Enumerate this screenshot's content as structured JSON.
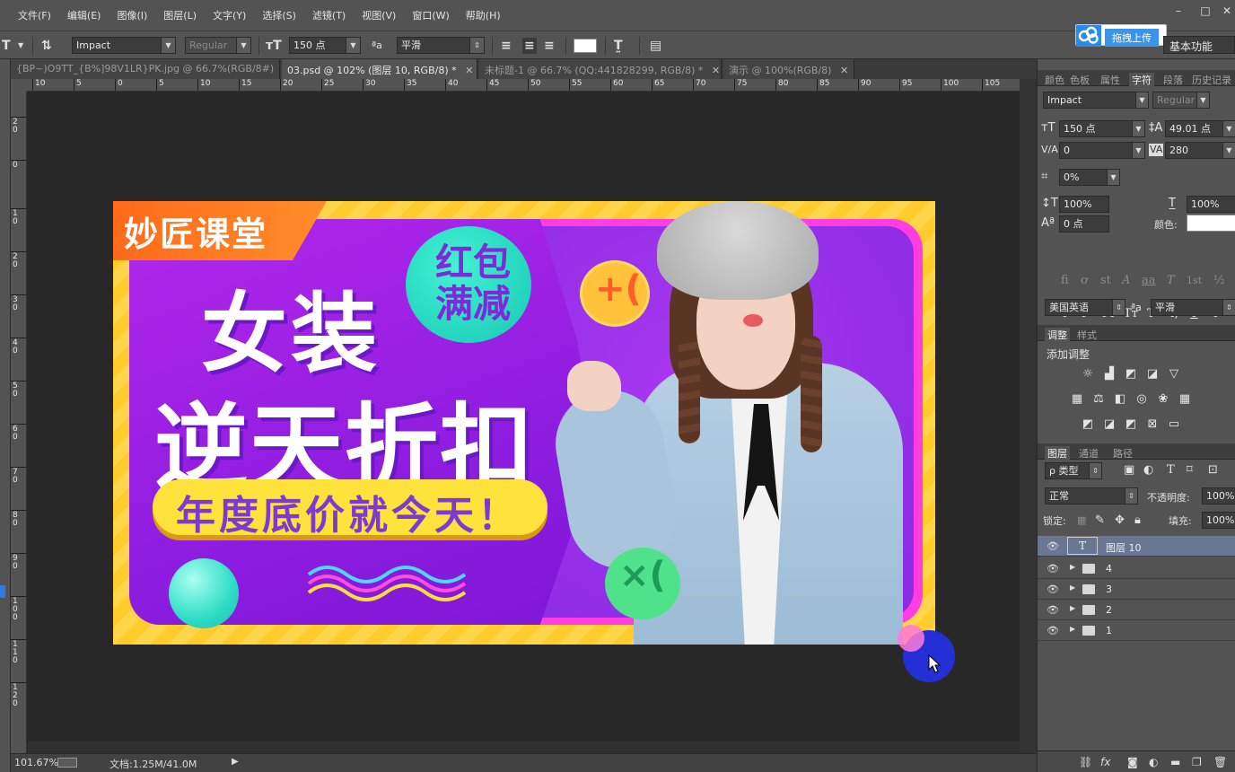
{
  "menubar": {
    "items": [
      "文件(F)",
      "编辑(E)",
      "图像(I)",
      "图层(L)",
      "文字(Y)",
      "选择(S)",
      "滤镜(T)",
      "视图(V)",
      "窗口(W)",
      "帮助(H)"
    ]
  },
  "window_controls": {
    "minimize": "–",
    "restore": "□",
    "close": "✕"
  },
  "options_bar": {
    "tool_glyph": "T",
    "font_family": "Impact",
    "font_style": "Regular",
    "font_size": "150 点",
    "aa_label": "ªa",
    "antialias": "平滑",
    "text_color": "#ffffff"
  },
  "cloud_upload": {
    "label": "拖拽上传"
  },
  "workspace": {
    "label": "基本功能"
  },
  "tabs": [
    {
      "label": "{BP~)O9TT_{B%]98V1LR}PK.jpg @ 66.7%(RGB/8#)",
      "close": "✕",
      "active": false
    },
    {
      "label": "03.psd @ 102% (图层 10, RGB/8) *",
      "close": "✕",
      "active": true
    },
    {
      "label": "未标题-1 @ 66.7% (QQ:441828299, RGB/8) *",
      "close": "✕",
      "active": false
    },
    {
      "label": "演示 @ 100%(RGB/8)",
      "close": "✕",
      "active": false
    }
  ],
  "hruler_labels": [
    "10",
    "5",
    "0",
    "5",
    "10",
    "15",
    "20",
    "25",
    "30",
    "35",
    "40",
    "45",
    "50",
    "55",
    "60",
    "65",
    "70",
    "75",
    "80",
    "85",
    "90",
    "95",
    "100",
    "105"
  ],
  "vruler_labels": [
    "20",
    "0",
    "10",
    "20",
    "30",
    "40",
    "50",
    "60",
    "70",
    "80",
    "90",
    "100",
    "110",
    "120"
  ],
  "banner": {
    "brand": "妙匠课堂",
    "bubble_line1": "红包",
    "bubble_line2": "满减",
    "headline1": "女装",
    "headline2": "逆天折扣",
    "pill": "年度底价就今天！",
    "emoji_happy": "+(",
    "emoji_sad": "×("
  },
  "statusbar": {
    "zoom": "101.67%",
    "doc": "文档:1.25M/41.0M",
    "play": "▶"
  },
  "panels": {
    "top_tabs": [
      "颜色",
      "色板",
      "属性",
      "字符",
      "段落",
      "历史记录"
    ],
    "character": {
      "font_family": "Impact",
      "font_style": "Regular",
      "size": "150 点",
      "leading": "49.01 点",
      "kerning": "0",
      "tracking": "280",
      "tsume": "0%",
      "vscale": "100%",
      "hscale": "100%",
      "baseline": "0 点",
      "color_label": "颜色:",
      "language": "美国英语",
      "aa_label": "ªa",
      "antialias": "平滑",
      "type_styles": [
        "T",
        "T",
        "TT",
        "Tт",
        "T¹",
        "T,",
        "T",
        "T"
      ],
      "ot_features": [
        "fi",
        "ơ",
        "st",
        "A",
        "aa",
        "T",
        "1st",
        "½"
      ]
    },
    "adjust_tabs": [
      "调整",
      "样式"
    ],
    "adjust_title": "添加调整",
    "layers_tabs": [
      "图层",
      "通道",
      "路径"
    ],
    "layers": {
      "filter": "ρ 类型",
      "blend": "正常",
      "opacity_label": "不透明度:",
      "opacity": "100%",
      "lock_label": "锁定:",
      "fill_label": "填充:",
      "fill": "100%",
      "rows": [
        {
          "name": "图层 10",
          "kind": "text",
          "thumb": "T"
        },
        {
          "name": "4",
          "kind": "group"
        },
        {
          "name": "3",
          "kind": "group"
        },
        {
          "name": "2",
          "kind": "group"
        },
        {
          "name": "1",
          "kind": "group"
        }
      ]
    }
  }
}
